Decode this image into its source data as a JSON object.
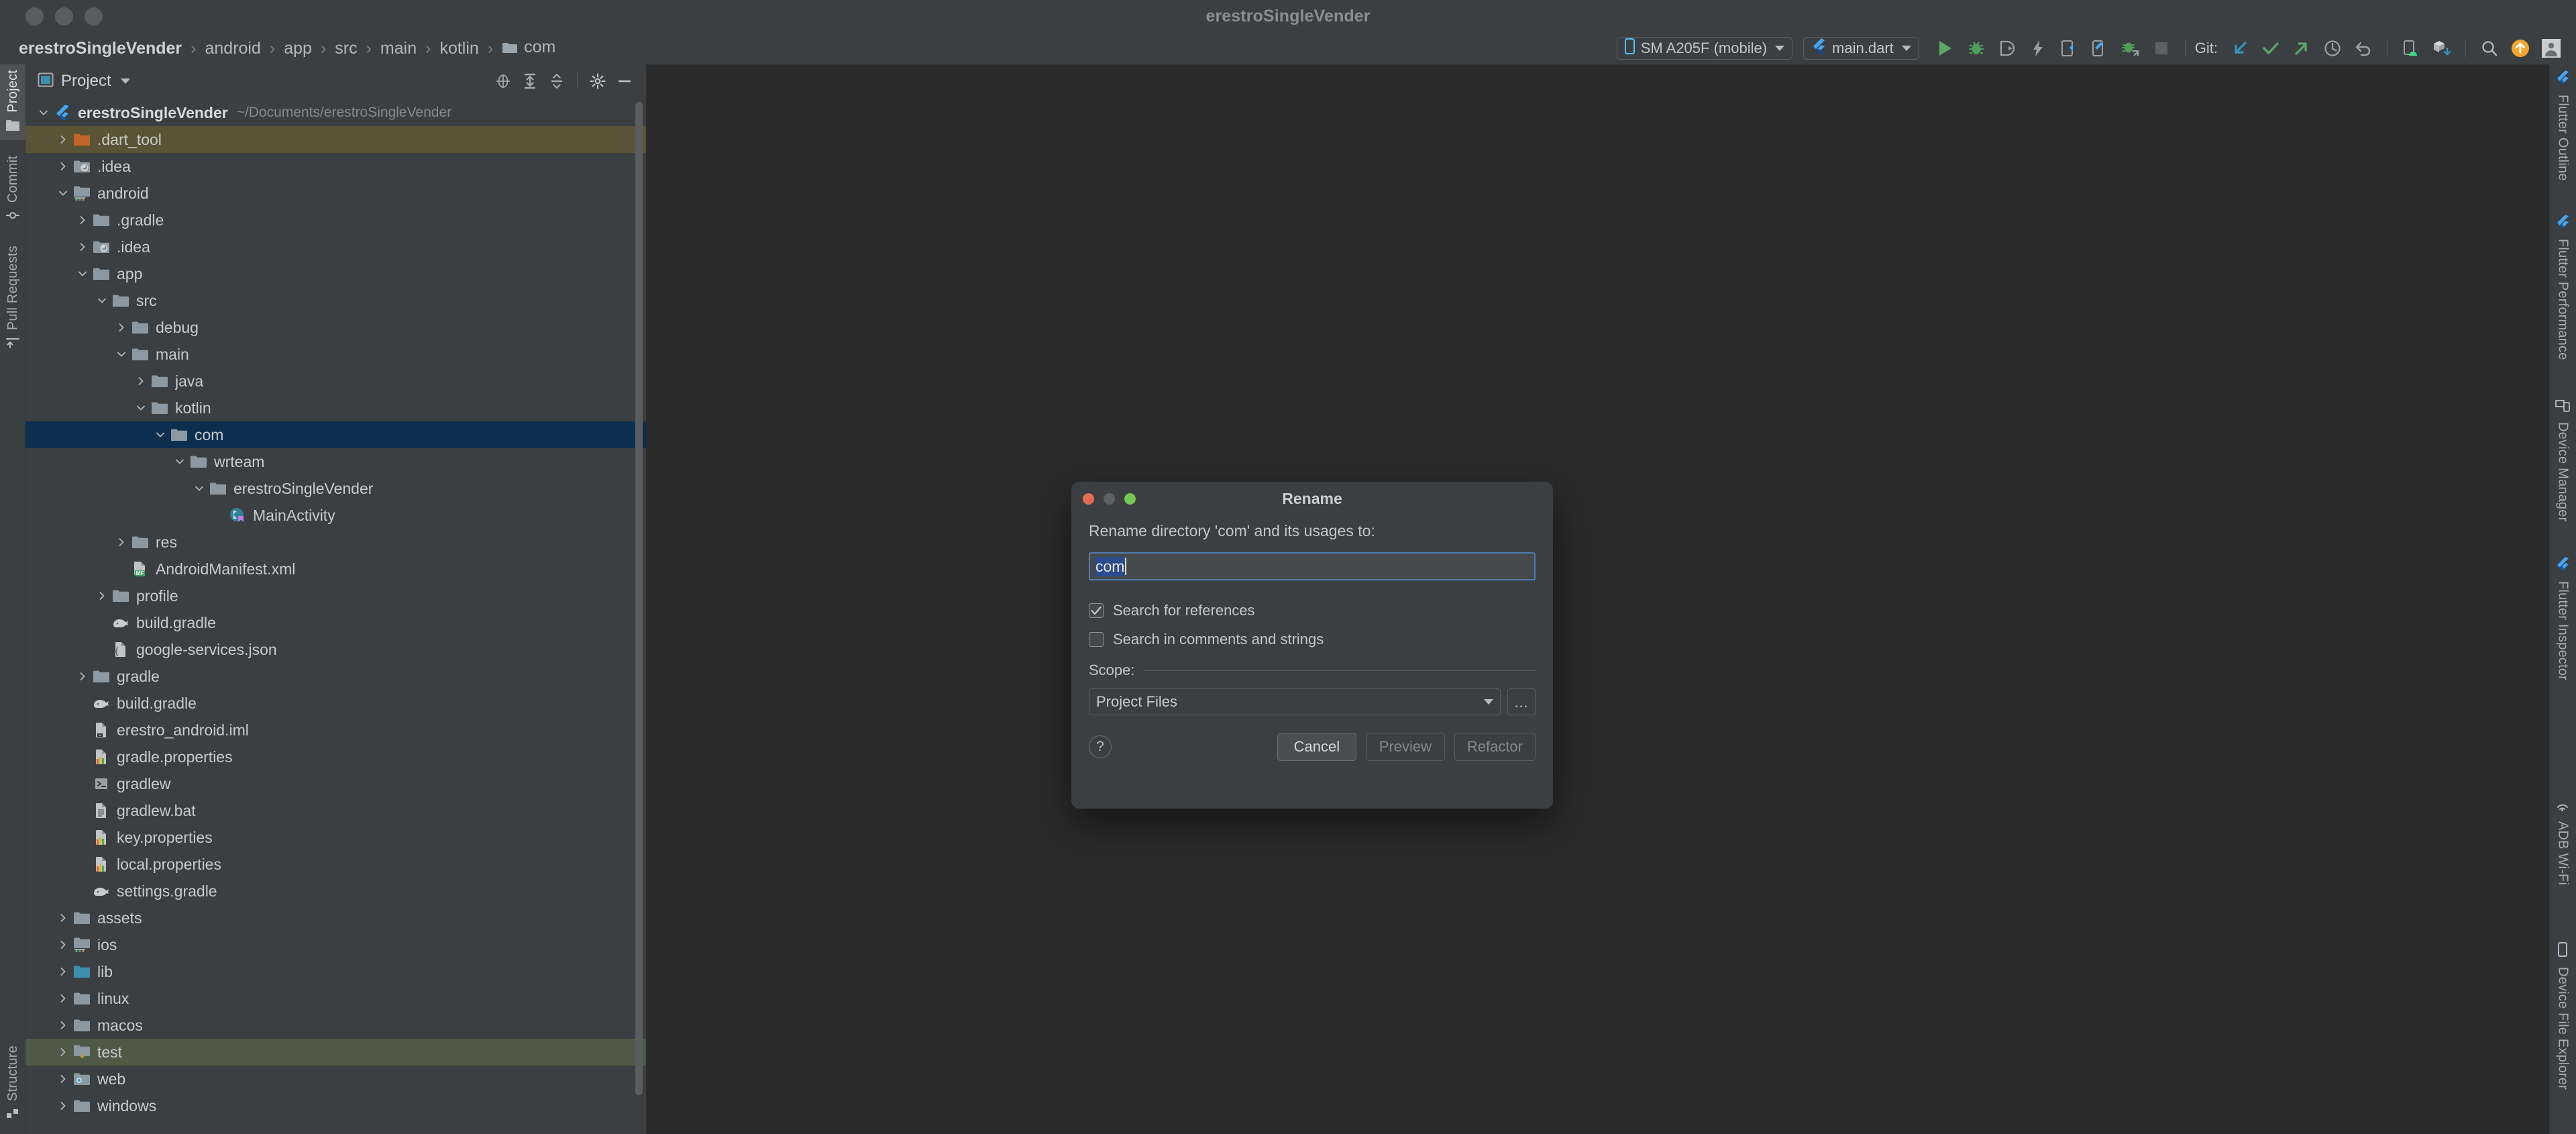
{
  "window": {
    "title": "erestroSingleVender",
    "traffic_lights": [
      "close-button",
      "minimize-button",
      "zoom-button"
    ]
  },
  "breadcrumb": {
    "items": [
      {
        "label": "erestroSingleVender",
        "icon": "",
        "root": true
      },
      {
        "label": "android",
        "icon": ""
      },
      {
        "label": "app",
        "icon": ""
      },
      {
        "label": "src",
        "icon": ""
      },
      {
        "label": "main",
        "icon": ""
      },
      {
        "label": "kotlin",
        "icon": ""
      },
      {
        "label": "com",
        "icon": "folder-icon"
      }
    ],
    "separator": "›"
  },
  "toolbar": {
    "device_selector": {
      "label": "SM A205F (mobile)",
      "icon": "phone-icon"
    },
    "run_config": {
      "label": "main.dart",
      "icon": "flutter-icon"
    },
    "actions": [
      {
        "name": "run-button",
        "icon": "play-icon"
      },
      {
        "name": "debug-button",
        "icon": "bug-icon"
      },
      {
        "name": "profile-button",
        "icon": "profile-icon"
      },
      {
        "name": "flutter-hot-reload-button",
        "icon": "lightning-icon"
      },
      {
        "name": "open-devtools-button",
        "icon": "devtools-icon"
      },
      {
        "name": "flutter-device-button",
        "icon": "phone-flutter-icon"
      },
      {
        "name": "attach-debugger-button",
        "icon": "bug-attach-icon"
      },
      {
        "name": "stop-button",
        "icon": "stop-icon"
      }
    ],
    "git_label": "Git:",
    "git_actions": [
      {
        "name": "git-update-project-button",
        "icon": "pull-arrow-icon"
      },
      {
        "name": "git-commit-button",
        "icon": "check-icon"
      },
      {
        "name": "git-push-button",
        "icon": "push-arrow-icon"
      },
      {
        "name": "git-history-button",
        "icon": "clock-icon"
      },
      {
        "name": "git-rollback-button",
        "icon": "undo-icon"
      }
    ],
    "right_actions": [
      {
        "name": "avd-manager-button",
        "icon": "android-device-icon"
      },
      {
        "name": "sdk-manager-button",
        "icon": "sdk-box-icon"
      },
      {
        "name": "search-everywhere-button",
        "icon": "search-icon"
      },
      {
        "name": "updates-button",
        "icon": "update-arrow-icon"
      },
      {
        "name": "account-button",
        "icon": "avatar-icon"
      }
    ]
  },
  "left_tool_strip": {
    "top": [
      {
        "label": "Project",
        "icon": "project-folder-icon",
        "active": true
      },
      {
        "label": "Commit",
        "icon": "commit-icon",
        "active": false
      },
      {
        "label": "Pull Requests",
        "icon": "pull-request-icon",
        "active": false
      }
    ],
    "bottom": [
      {
        "label": "Structure",
        "icon": "structure-icon",
        "active": false
      }
    ]
  },
  "right_tool_strip": {
    "top": [
      {
        "label": "Flutter Outline",
        "icon": "flutter-icon"
      },
      {
        "label": "Flutter Performance",
        "icon": "flutter-icon"
      },
      {
        "label": "Device Manager",
        "icon": "device-manager-icon"
      },
      {
        "label": "Flutter Inspector",
        "icon": "flutter-icon"
      }
    ],
    "bottom": [
      {
        "label": "ADB Wi-Fi",
        "icon": "wifi-icon"
      },
      {
        "label": "Device File Explorer",
        "icon": "phone-icon"
      }
    ]
  },
  "project_panel": {
    "title": "Project",
    "actions": [
      {
        "name": "select-opened-file-button",
        "icon": "target-icon"
      },
      {
        "name": "expand-all-button",
        "icon": "expand-all-icon"
      },
      {
        "name": "collapse-all-button",
        "icon": "collapse-all-icon"
      },
      {
        "name": "panel-settings-button",
        "icon": "gear-icon"
      },
      {
        "name": "hide-panel-button",
        "icon": "minus-icon"
      }
    ],
    "tree": [
      {
        "label": "erestroSingleVender",
        "sub": "~/Documents/erestroSingleVender",
        "depth": 0,
        "arrow": "down",
        "icon": "flutter-icon",
        "bold": true,
        "state": ""
      },
      {
        "label": ".dart_tool",
        "sub": "",
        "depth": 1,
        "arrow": "right",
        "icon": "folder-excluded-icon",
        "bold": false,
        "state": "excl"
      },
      {
        "label": ".idea",
        "sub": "",
        "depth": 1,
        "arrow": "right",
        "icon": "folder-idea-icon",
        "bold": false,
        "state": ""
      },
      {
        "label": "android",
        "sub": "",
        "depth": 1,
        "arrow": "down",
        "icon": "folder-module-icon",
        "bold": false,
        "state": ""
      },
      {
        "label": ".gradle",
        "sub": "",
        "depth": 2,
        "arrow": "right",
        "icon": "folder-icon",
        "bold": false,
        "state": ""
      },
      {
        "label": ".idea",
        "sub": "",
        "depth": 2,
        "arrow": "right",
        "icon": "folder-idea-icon",
        "bold": false,
        "state": ""
      },
      {
        "label": "app",
        "sub": "",
        "depth": 2,
        "arrow": "down",
        "icon": "folder-icon",
        "bold": false,
        "state": ""
      },
      {
        "label": "src",
        "sub": "",
        "depth": 3,
        "arrow": "down",
        "icon": "folder-icon",
        "bold": false,
        "state": ""
      },
      {
        "label": "debug",
        "sub": "",
        "depth": 4,
        "arrow": "right",
        "icon": "folder-icon",
        "bold": false,
        "state": ""
      },
      {
        "label": "main",
        "sub": "",
        "depth": 4,
        "arrow": "down",
        "icon": "folder-icon",
        "bold": false,
        "state": ""
      },
      {
        "label": "java",
        "sub": "",
        "depth": 5,
        "arrow": "right",
        "icon": "folder-icon",
        "bold": false,
        "state": ""
      },
      {
        "label": "kotlin",
        "sub": "",
        "depth": 5,
        "arrow": "down",
        "icon": "folder-icon",
        "bold": false,
        "state": ""
      },
      {
        "label": "com",
        "sub": "",
        "depth": 6,
        "arrow": "down",
        "icon": "folder-icon",
        "bold": false,
        "state": "sel"
      },
      {
        "label": "wrteam",
        "sub": "",
        "depth": 7,
        "arrow": "down",
        "icon": "folder-icon",
        "bold": false,
        "state": ""
      },
      {
        "label": "erestroSingleVender",
        "sub": "",
        "depth": 8,
        "arrow": "down",
        "icon": "folder-icon",
        "bold": false,
        "state": ""
      },
      {
        "label": "MainActivity",
        "sub": "",
        "depth": 9,
        "arrow": "none",
        "icon": "kotlin-class-icon",
        "bold": false,
        "state": ""
      },
      {
        "label": "res",
        "sub": "",
        "depth": 4,
        "arrow": "right",
        "icon": "folder-icon",
        "bold": false,
        "state": ""
      },
      {
        "label": "AndroidManifest.xml",
        "sub": "",
        "depth": 4,
        "arrow": "none",
        "icon": "manifest-icon",
        "bold": false,
        "state": ""
      },
      {
        "label": "profile",
        "sub": "",
        "depth": 3,
        "arrow": "right",
        "icon": "folder-icon",
        "bold": false,
        "state": ""
      },
      {
        "label": "build.gradle",
        "sub": "",
        "depth": 3,
        "arrow": "none",
        "icon": "gradle-icon",
        "bold": false,
        "state": ""
      },
      {
        "label": "google-services.json",
        "sub": "",
        "depth": 3,
        "arrow": "none",
        "icon": "json-file-icon",
        "bold": false,
        "state": ""
      },
      {
        "label": "gradle",
        "sub": "",
        "depth": 2,
        "arrow": "right",
        "icon": "folder-icon",
        "bold": false,
        "state": ""
      },
      {
        "label": "build.gradle",
        "sub": "",
        "depth": 2,
        "arrow": "none",
        "icon": "gradle-icon",
        "bold": false,
        "state": ""
      },
      {
        "label": "erestro_android.iml",
        "sub": "",
        "depth": 2,
        "arrow": "none",
        "icon": "iml-file-icon",
        "bold": false,
        "state": ""
      },
      {
        "label": "gradle.properties",
        "sub": "",
        "depth": 2,
        "arrow": "none",
        "icon": "properties-file-icon",
        "bold": false,
        "state": ""
      },
      {
        "label": "gradlew",
        "sub": "",
        "depth": 2,
        "arrow": "none",
        "icon": "shell-script-icon",
        "bold": false,
        "state": ""
      },
      {
        "label": "gradlew.bat",
        "sub": "",
        "depth": 2,
        "arrow": "none",
        "icon": "text-file-icon",
        "bold": false,
        "state": ""
      },
      {
        "label": "key.properties",
        "sub": "",
        "depth": 2,
        "arrow": "none",
        "icon": "properties-file-icon",
        "bold": false,
        "state": ""
      },
      {
        "label": "local.properties",
        "sub": "",
        "depth": 2,
        "arrow": "none",
        "icon": "properties-file-icon",
        "bold": false,
        "state": ""
      },
      {
        "label": "settings.gradle",
        "sub": "",
        "depth": 2,
        "arrow": "none",
        "icon": "gradle-icon",
        "bold": false,
        "state": ""
      },
      {
        "label": "assets",
        "sub": "",
        "depth": 1,
        "arrow": "right",
        "icon": "folder-icon",
        "bold": false,
        "state": ""
      },
      {
        "label": "ios",
        "sub": "",
        "depth": 1,
        "arrow": "right",
        "icon": "folder-module-icon",
        "bold": false,
        "state": ""
      },
      {
        "label": "lib",
        "sub": "",
        "depth": 1,
        "arrow": "right",
        "icon": "folder-source-icon",
        "bold": false,
        "state": ""
      },
      {
        "label": "linux",
        "sub": "",
        "depth": 1,
        "arrow": "right",
        "icon": "folder-icon",
        "bold": false,
        "state": ""
      },
      {
        "label": "macos",
        "sub": "",
        "depth": 1,
        "arrow": "right",
        "icon": "folder-icon",
        "bold": false,
        "state": ""
      },
      {
        "label": "test",
        "sub": "",
        "depth": 1,
        "arrow": "right",
        "icon": "folder-test-icon",
        "bold": false,
        "state": "testroot"
      },
      {
        "label": "web",
        "sub": "",
        "depth": 1,
        "arrow": "right",
        "icon": "folder-web-icon",
        "bold": false,
        "state": ""
      },
      {
        "label": "windows",
        "sub": "",
        "depth": 1,
        "arrow": "right",
        "icon": "folder-icon",
        "bold": false,
        "state": ""
      }
    ]
  },
  "dialog": {
    "title": "Rename",
    "prompt": "Rename directory 'com' and its usages to:",
    "input_value": "com",
    "checkboxes": [
      {
        "label": "Search for references",
        "checked": true
      },
      {
        "label": "Search in comments and strings",
        "checked": false
      }
    ],
    "scope_label": "Scope:",
    "scope_value": "Project Files",
    "scope_browse_label": "…",
    "help_label": "?",
    "buttons": [
      {
        "label": "Cancel",
        "enabled": true
      },
      {
        "label": "Preview",
        "enabled": false
      },
      {
        "label": "Refactor",
        "enabled": false
      }
    ]
  },
  "colors": {
    "accent_blue": "#3d7ec1",
    "selection_row": "#0d2f4f",
    "excluded_row": "#5b5335",
    "test_root_row": "#4e5a45",
    "editor_bg": "#2b2b2b",
    "chrome_bg": "#3c3f41",
    "flutter_blue": "#44c0f1",
    "green_run": "#4caf50"
  }
}
